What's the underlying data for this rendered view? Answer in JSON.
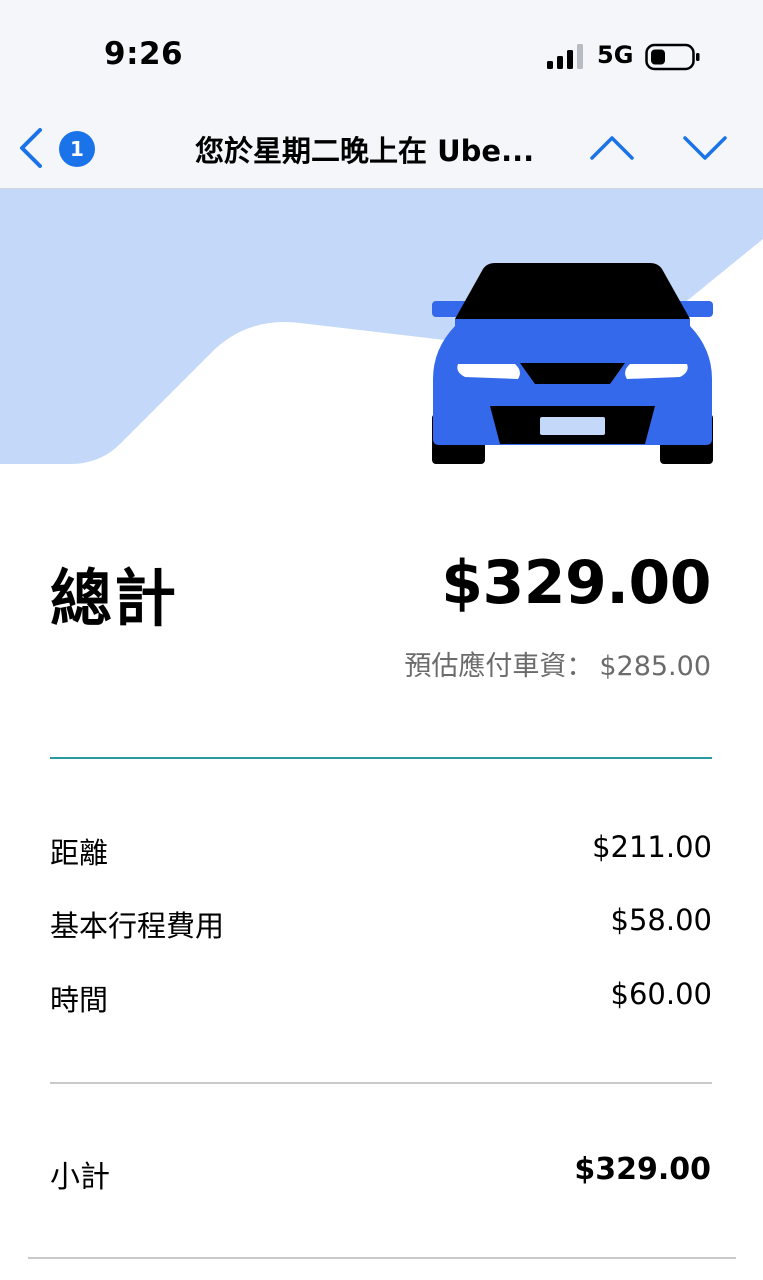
{
  "status_bar": {
    "time": "9:26",
    "network": "5G",
    "signal_icon": "cellular-signal-icon",
    "battery_icon": "battery-icon"
  },
  "nav": {
    "back_icon": "chevron-left-icon",
    "unread_count": "1",
    "title": "您於星期二晚上在 Ube...",
    "prev_icon": "chevron-up-icon",
    "next_icon": "chevron-down-icon"
  },
  "hero": {
    "illustration": "car-icon",
    "colors": {
      "banner": "#c4d8fa",
      "car_body": "#3369ea",
      "car_dark": "#000000",
      "headlight": "#ffffff",
      "plate": "#c4d8fa"
    }
  },
  "receipt": {
    "total_label": "總計",
    "total_amount": "$329.00",
    "estimate_label": "預估應付車資：",
    "estimate_amount": "$285.00",
    "line_items": [
      {
        "label": "距離",
        "amount": "$211.00"
      },
      {
        "label": "基本行程費用",
        "amount": "$58.00"
      },
      {
        "label": "時間",
        "amount": "$60.00"
      }
    ],
    "subtotal_label": "小計",
    "subtotal_amount": "$329.00"
  },
  "colors": {
    "accent_blue": "#1a73e8",
    "divider_teal": "#2a9aa0",
    "muted_text": "#6b6b6b"
  }
}
